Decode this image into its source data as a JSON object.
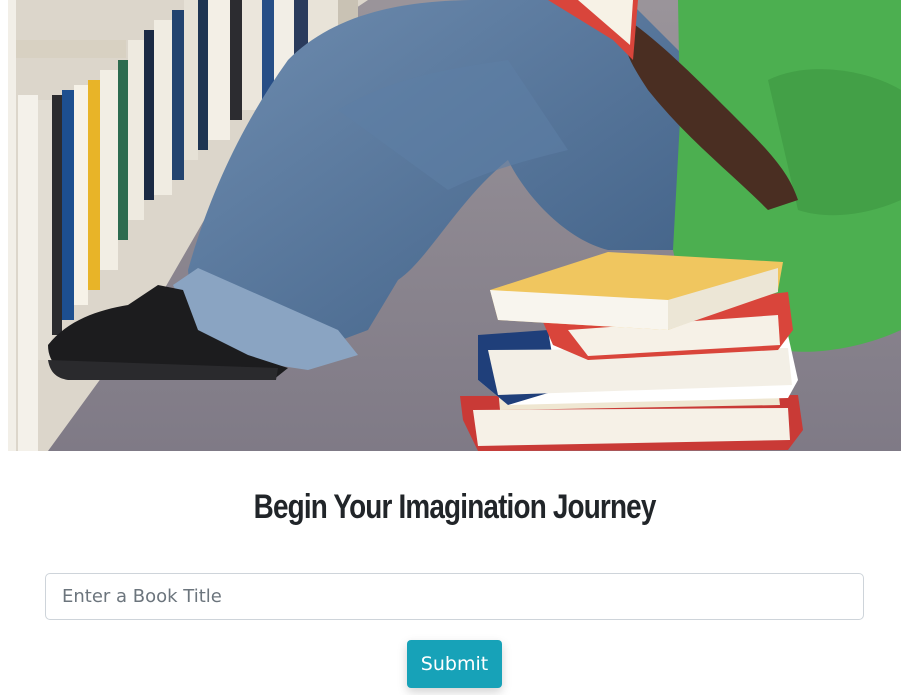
{
  "hero": {
    "image_name": "student-reading-books-photo",
    "colors": {
      "carpet": "#8b8791",
      "jeans": "#4d6f95",
      "shirt": "#4caf50",
      "shoe": "#1c1c1e",
      "shelf": "#e9e4da"
    }
  },
  "heading": "Begin Your Imagination Journey",
  "form": {
    "book_title_placeholder": "Enter a Book Title",
    "book_title_value": "",
    "submit_label": "Submit"
  },
  "colors": {
    "accent": "#17a2b8",
    "text": "#212529",
    "border": "#ced4da"
  }
}
